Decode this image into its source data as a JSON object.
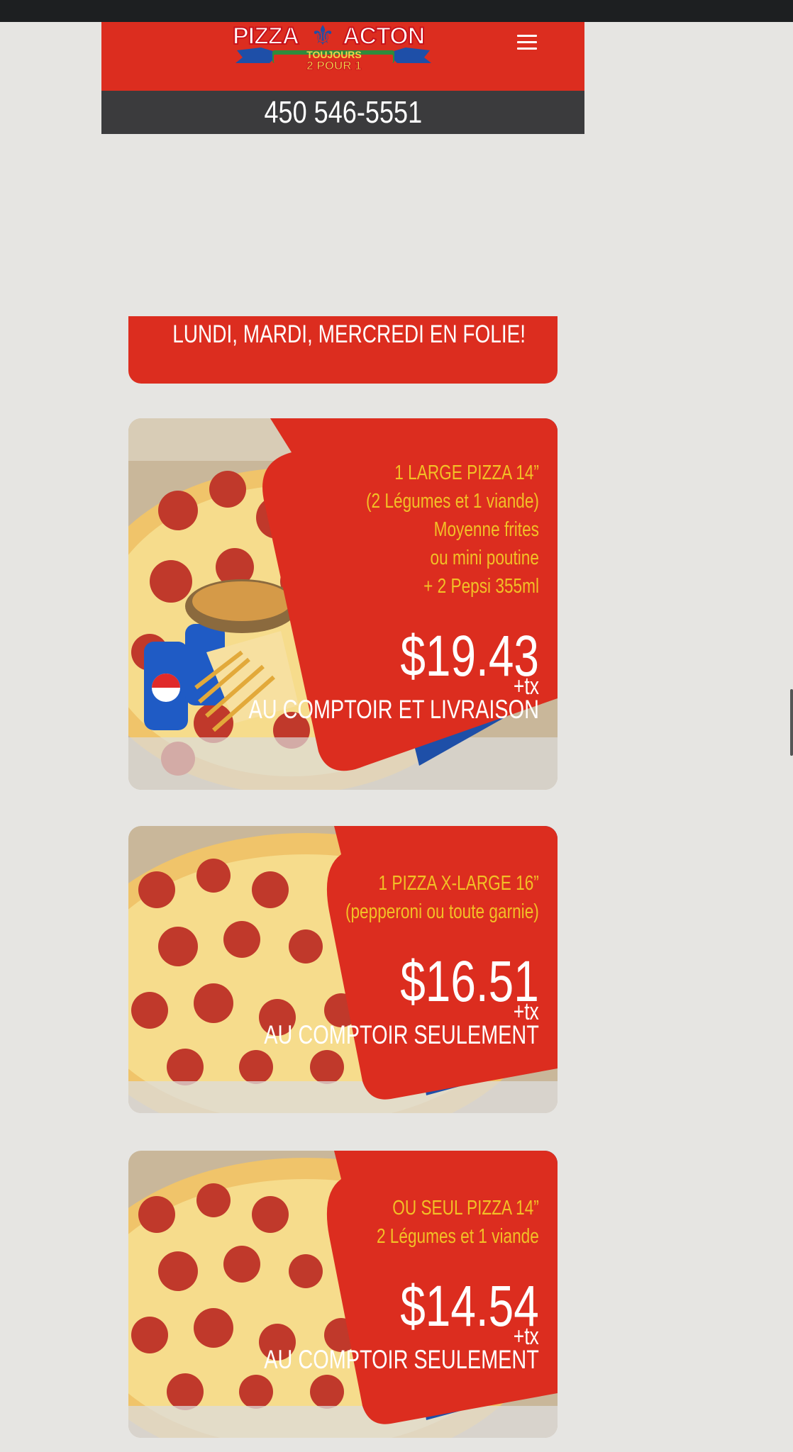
{
  "header": {
    "logo_text": {
      "left": "PIZZA",
      "right": "ACTON",
      "ribbon_top": "TOUJOURS",
      "ribbon_bottom": "2 POUR 1"
    },
    "menu_icon": "hamburger-menu-icon",
    "phone": "450 546-5551"
  },
  "banner": {
    "text": "LUNDI, MARDI, MERCREDI EN FOLIE!"
  },
  "offers": [
    {
      "lines": [
        "1 LARGE PIZZA 14”",
        "(2 Légumes et 1 viande)",
        "Moyenne frites",
        "ou mini poutine",
        "+ 2 Pepsi 355ml"
      ],
      "price": "$19.43",
      "tax": "+tx",
      "mode": "AU COMPTOIR ET LIVRAISON"
    },
    {
      "lines": [
        "1 PIZZA X-LARGE 16”",
        "(pepperoni ou toute garnie)"
      ],
      "price": "$16.51",
      "tax": "+tx",
      "mode": "AU COMPTOIR SEULEMENT"
    },
    {
      "lines": [
        "OU SEUL PIZZA 14”",
        "2 Légumes et 1 viande"
      ],
      "price": "$14.54",
      "tax": "+tx",
      "mode": "AU COMPTOIR SEULEMENT"
    }
  ],
  "colors": {
    "brand_red": "#dc2d1f",
    "accent_blue": "#1e4fa8",
    "accent_yellow": "#f2c026",
    "page_bg": "#e6e5e2",
    "phone_bar": "#3b3b3d"
  }
}
